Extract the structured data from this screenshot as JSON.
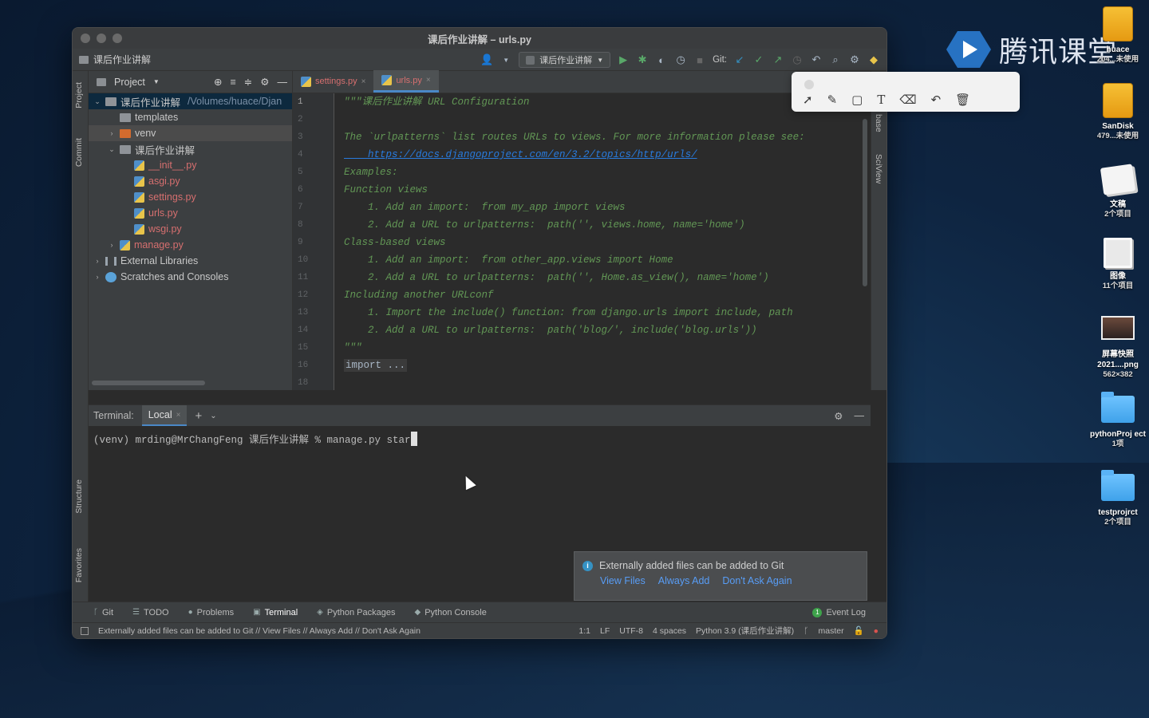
{
  "watermark": {
    "text": "腾讯课堂"
  },
  "desktop": [
    {
      "label": "huace",
      "sub": "204...未使用",
      "kind": "drive"
    },
    {
      "label": "SanDisk",
      "sub": "479...未使用",
      "kind": "drive"
    },
    {
      "label": "文稿",
      "sub": "2个项目",
      "kind": "docs"
    },
    {
      "label": "图像",
      "sub": "11个项目",
      "kind": "images"
    },
    {
      "label": "屏幕快照 2021....png",
      "sub": "562×382",
      "kind": "thumb"
    },
    {
      "label": "pythonProj ect",
      "sub": "1项",
      "kind": "folder"
    },
    {
      "label": "testprojrct",
      "sub": "2个项目",
      "kind": "folder"
    }
  ],
  "window": {
    "title": "课后作业讲解 – urls.py",
    "breadcrumb": "课后作业讲解",
    "run_config": "课后作业讲解",
    "git_label": "Git:"
  },
  "left_strip": {
    "project": "Project",
    "commit": "Commit",
    "structure": "Structure",
    "favorites": "Favorites"
  },
  "right_strip": {
    "database": "base",
    "sciview": "SciView"
  },
  "project_panel": {
    "title": "Project",
    "tree": [
      {
        "label": "课后作业讲解",
        "path": "/Volumes/huace/Djan",
        "indent": 0,
        "arrow": "v",
        "icon": "dir",
        "color": "normal"
      },
      {
        "label": "templates",
        "indent": 1,
        "arrow": "",
        "icon": "dir",
        "color": "normal"
      },
      {
        "label": "venv",
        "indent": 1,
        "arrow": ">",
        "icon": "dir-orange",
        "color": "normal"
      },
      {
        "label": "课后作业讲解",
        "indent": 1,
        "arrow": "v",
        "icon": "dir",
        "color": "normal"
      },
      {
        "label": "__init__.py",
        "indent": 2,
        "arrow": "",
        "icon": "py",
        "color": "red"
      },
      {
        "label": "asgi.py",
        "indent": 2,
        "arrow": "",
        "icon": "py",
        "color": "red"
      },
      {
        "label": "settings.py",
        "indent": 2,
        "arrow": "",
        "icon": "py",
        "color": "red"
      },
      {
        "label": "urls.py",
        "indent": 2,
        "arrow": "",
        "icon": "py",
        "color": "red"
      },
      {
        "label": "wsgi.py",
        "indent": 2,
        "arrow": "",
        "icon": "py",
        "color": "red"
      },
      {
        "label": "manage.py",
        "indent": 1,
        "arrow": ">",
        "icon": "py",
        "color": "red"
      },
      {
        "label": "External Libraries",
        "indent": 0,
        "arrow": ">",
        "icon": "lib",
        "color": "normal"
      },
      {
        "label": "Scratches and Consoles",
        "indent": 0,
        "arrow": ">",
        "icon": "scratch",
        "color": "normal"
      }
    ]
  },
  "editor": {
    "tabs": [
      {
        "label": "settings.py",
        "active": false
      },
      {
        "label": "urls.py",
        "active": true
      }
    ],
    "lines": [
      {
        "n": "1",
        "text": "\"\"\"课后作业讲解 URL Configuration",
        "style": "doc"
      },
      {
        "n": "2",
        "text": "",
        "style": "doc"
      },
      {
        "n": "3",
        "text": "The `urlpatterns` list routes URLs to views. For more information please see:",
        "style": "doc"
      },
      {
        "n": "4",
        "text": "    https://docs.djangoproject.com/en/3.2/topics/http/urls/",
        "style": "link"
      },
      {
        "n": "5",
        "text": "Examples:",
        "style": "doc"
      },
      {
        "n": "6",
        "text": "Function views",
        "style": "doc"
      },
      {
        "n": "7",
        "text": "    1. Add an import:  from my_app import views",
        "style": "doc"
      },
      {
        "n": "8",
        "text": "    2. Add a URL to urlpatterns:  path('', views.home, name='home')",
        "style": "doc"
      },
      {
        "n": "9",
        "text": "Class-based views",
        "style": "doc"
      },
      {
        "n": "10",
        "text": "    1. Add an import:  from other_app.views import Home",
        "style": "doc"
      },
      {
        "n": "11",
        "text": "    2. Add a URL to urlpatterns:  path('', Home.as_view(), name='home')",
        "style": "doc"
      },
      {
        "n": "12",
        "text": "Including another URLconf",
        "style": "doc"
      },
      {
        "n": "13",
        "text": "    1. Import the include() function: from django.urls import include, path",
        "style": "doc"
      },
      {
        "n": "14",
        "text": "    2. Add a URL to urlpatterns:  path('blog/', include('blog.urls'))",
        "style": "doc"
      },
      {
        "n": "15",
        "text": "\"\"\"",
        "style": "doc"
      },
      {
        "n": "16",
        "text": "import ...",
        "style": "kw"
      },
      {
        "n": "18",
        "text": "",
        "style": "doc"
      }
    ]
  },
  "terminal": {
    "label": "Terminal:",
    "tab": "Local",
    "prompt": "(venv) mrding@MrChangFeng 课后作业讲解 % manage.py star"
  },
  "notification": {
    "message": "Externally added files can be added to Git",
    "links": [
      "View Files",
      "Always Add",
      "Don't Ask Again"
    ]
  },
  "bottom_tools": [
    {
      "label": "Git",
      "glyph": "ᚴ",
      "active": false
    },
    {
      "label": "TODO",
      "glyph": "☰",
      "active": false
    },
    {
      "label": "Problems",
      "glyph": "●",
      "active": false
    },
    {
      "label": "Terminal",
      "glyph": "▣",
      "active": true
    },
    {
      "label": "Python Packages",
      "glyph": "◈",
      "active": false
    },
    {
      "label": "Python Console",
      "glyph": "◆",
      "active": false
    }
  ],
  "event_log": {
    "badge": "1",
    "label": "Event Log"
  },
  "status": {
    "message": "Externally added files can be added to Git // View Files // Always Add // Don't Ask Again",
    "position": "1:1",
    "line_sep": "LF",
    "encoding": "UTF-8",
    "indent": "4 spaces",
    "interpreter": "Python 3.9 (课后作业讲解)",
    "branch": "master"
  }
}
